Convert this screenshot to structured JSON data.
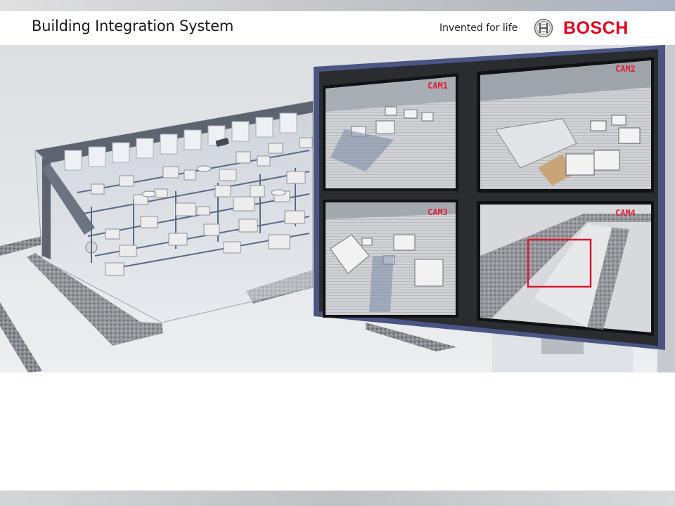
{
  "header": {
    "title": "Building Integration System",
    "slogan": "Invented for life",
    "brand": "BOSCH"
  },
  "cameras": [
    {
      "label": "CAM1"
    },
    {
      "label": "CAM2"
    },
    {
      "label": "CAM3"
    },
    {
      "label": "CAM4"
    }
  ],
  "colors": {
    "brand_red": "#e2001a",
    "monitor_frame": "#4b5584",
    "highlight_box": "#d8182f"
  },
  "icons": {
    "logo": "bosch-armature-emblem"
  }
}
